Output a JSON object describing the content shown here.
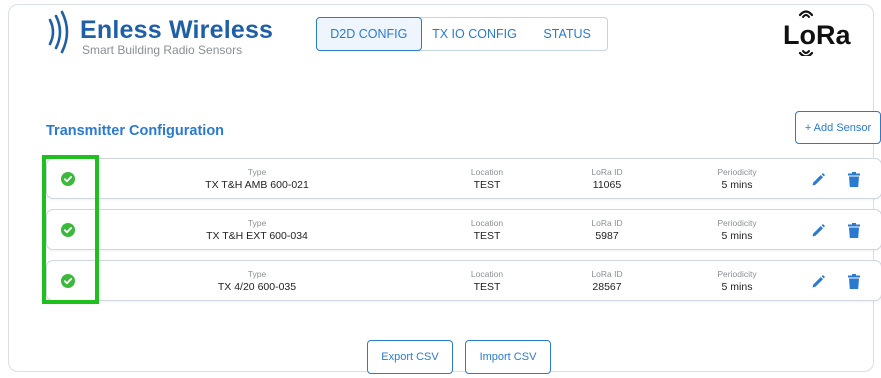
{
  "brand": {
    "name": "Enless Wireless",
    "tagline": "Smart Building Radio Sensors"
  },
  "nav": {
    "tabs": [
      {
        "label": "D2D CONFIG",
        "active": true
      },
      {
        "label": "TX IO CONFIG",
        "active": false
      },
      {
        "label": "STATUS",
        "active": false
      }
    ]
  },
  "logo": {
    "text": "LoRa"
  },
  "section": {
    "title": "Transmitter Configuration",
    "add_button": "+ Add Sensor"
  },
  "columns": {
    "type": "Type",
    "location": "Location",
    "lora_id": "LoRa ID",
    "periodicity": "Periodicity"
  },
  "sensors": [
    {
      "status": "ok",
      "type": "TX T&H AMB 600-021",
      "location": "TEST",
      "lora_id": "11065",
      "periodicity": "5 mins"
    },
    {
      "status": "ok",
      "type": "TX T&H EXT 600-034",
      "location": "TEST",
      "lora_id": "5987",
      "periodicity": "5 mins"
    },
    {
      "status": "ok",
      "type": "TX 4/20 600-035",
      "location": "TEST",
      "lora_id": "28567",
      "periodicity": "5 mins"
    }
  ],
  "footer": {
    "export_button": "Export CSV",
    "import_button": "Import CSV"
  },
  "colors": {
    "accent": "#2a7ad0",
    "brand": "#1e5fa8",
    "status_ok": "#3cb93c",
    "highlight": "#1fbf1f"
  },
  "icons": {
    "status": "check-circle-icon",
    "edit": "pencil-icon",
    "delete": "trash-icon"
  }
}
